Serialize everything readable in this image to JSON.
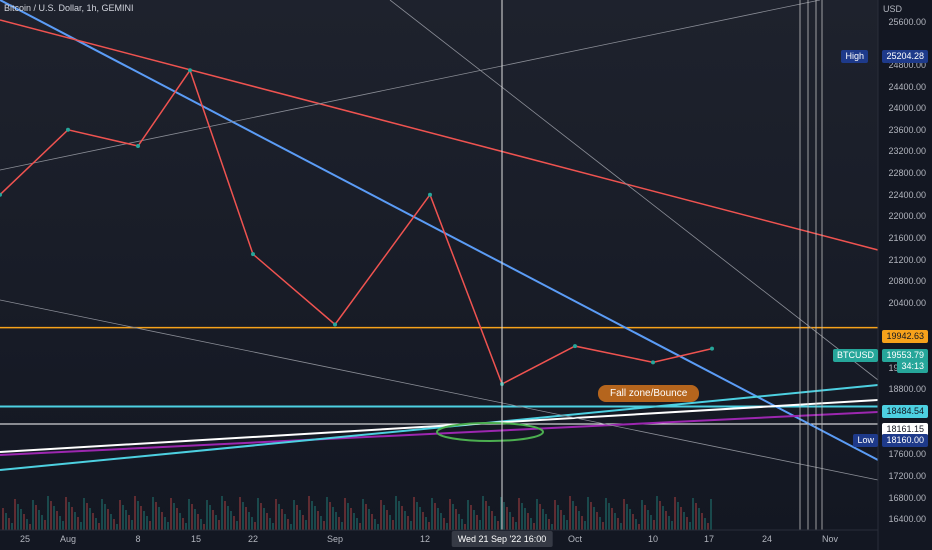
{
  "header": {
    "title": "Bitcoin / U.S. Dollar, 1h, GEMINI",
    "currency": "USD"
  },
  "price_axis": {
    "ticks": [
      "25600.00",
      "24800.00",
      "24400.00",
      "24000.00",
      "23600.00",
      "23200.00",
      "22800.00",
      "22400.00",
      "22000.00",
      "21600.00",
      "21200.00",
      "20800.00",
      "20400.00",
      "19200.00",
      "18800.00",
      "17600.00",
      "17200.00",
      "16800.00",
      "16400.00"
    ]
  },
  "time_axis": {
    "labels": [
      "25",
      "Aug",
      "8",
      "15",
      "22",
      "Sep",
      "12",
      "Oct",
      "10",
      "17",
      "24",
      "Nov"
    ]
  },
  "badges": {
    "high_label": "High",
    "high_value": "25204.28",
    "orange_value": "19942.63",
    "symbol_label": "BTCUSD",
    "symbol_value": "19553.79",
    "countdown": "34:13",
    "cyan_value": "18484.54",
    "white_value": "18161.15",
    "low_label": "Low",
    "low_value": "18160.00"
  },
  "crosshair": {
    "label": "Wed 21 Sep '22   16:00"
  },
  "annotation": {
    "text": "Fall zone/Bounce"
  },
  "colors": {
    "background": "#131722",
    "candle_up": "#26a69a",
    "candle_down": "#ef5350",
    "orange": "#f7a21b",
    "cyan": "#4dd0e1",
    "blue": "#5b9cf6",
    "red": "#ef5350",
    "purple": "#9c27b0",
    "green": "#4caf50"
  },
  "chart_data": {
    "type": "line",
    "title": "Bitcoin / U.S. Dollar, 1h, GEMINI",
    "ylabel": "USD",
    "ylim": [
      16200,
      26000
    ],
    "x": [
      "Jul 25",
      "Aug 1",
      "Aug 8",
      "Aug 15",
      "Aug 22",
      "Sep 1",
      "Sep 12",
      "Sep 21",
      "Oct 1",
      "Oct 10",
      "Oct 17"
    ],
    "series": [
      {
        "name": "BTCUSD",
        "values": [
          22400,
          23600,
          23300,
          24700,
          21300,
          20000,
          22400,
          18900,
          19600,
          19300,
          19553.79
        ]
      }
    ],
    "horizontal_levels": [
      19942.63,
      18484.54,
      18161.15
    ],
    "high": 25204.28,
    "low": 18160.0
  }
}
